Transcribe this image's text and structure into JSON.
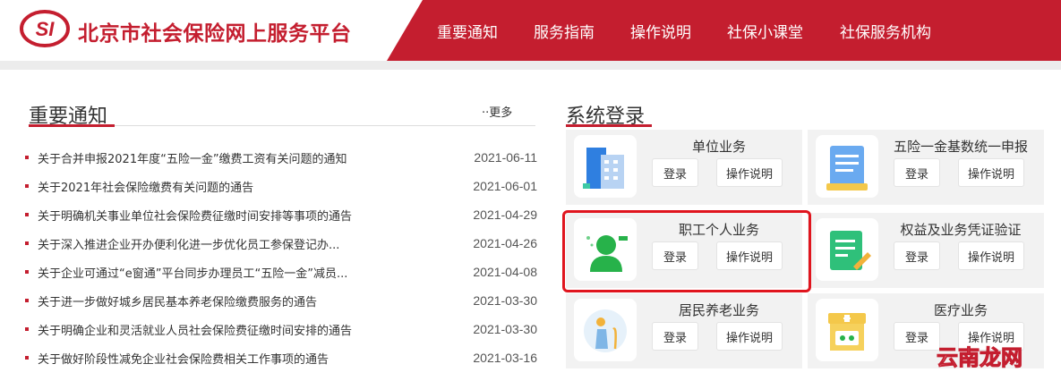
{
  "header": {
    "logo_mark": "SI",
    "logo_text": "北京市社会保险网上服务平台",
    "nav": [
      "重要通知",
      "服务指南",
      "操作说明",
      "社保小课堂",
      "社保服务机构"
    ]
  },
  "notices": {
    "title": "重要通知",
    "more": "··更多",
    "items": [
      {
        "title": "关于合并申报2021年度“五险一金”缴费工资有关问题的通知",
        "date": "2021-06-11"
      },
      {
        "title": "关于2021年社会保险缴费有关问题的通告",
        "date": "2021-06-01"
      },
      {
        "title": "关于明确机关事业单位社会保险费征缴时间安排等事项的通告",
        "date": "2021-04-29"
      },
      {
        "title": "关于深入推进企业开办便利化进一步优化员工参保登记办...",
        "date": "2021-04-26"
      },
      {
        "title": "关于企业可通过“e窗通”平台同步办理员工“五险一金”减员...",
        "date": "2021-04-08"
      },
      {
        "title": "关于进一步做好城乡居民基本养老保险缴费服务的通告",
        "date": "2021-03-30"
      },
      {
        "title": "关于明确企业和灵活就业人员社会保险费征缴时间安排的通告",
        "date": "2021-03-30"
      },
      {
        "title": "关于做好阶段性减免企业社会保险费相关工作事项的通告",
        "date": "2021-03-16"
      }
    ]
  },
  "login": {
    "title": "系统登录",
    "login_label": "登录",
    "guide_label": "操作说明",
    "services": [
      {
        "title": "单位业务",
        "icon": "building-icon"
      },
      {
        "title": "五险一金基数统一申报",
        "icon": "document-icon"
      },
      {
        "title": "职工个人业务",
        "icon": "person-icon"
      },
      {
        "title": "权益及业务凭证验证",
        "icon": "certificate-edit-icon"
      },
      {
        "title": "居民养老业务",
        "icon": "elderly-icon"
      },
      {
        "title": "医疗业务",
        "icon": "pharmacy-icon"
      }
    ]
  },
  "colors": {
    "brand": "#c41e2f",
    "highlight": "#e0151e"
  },
  "watermark": "云南龙网"
}
